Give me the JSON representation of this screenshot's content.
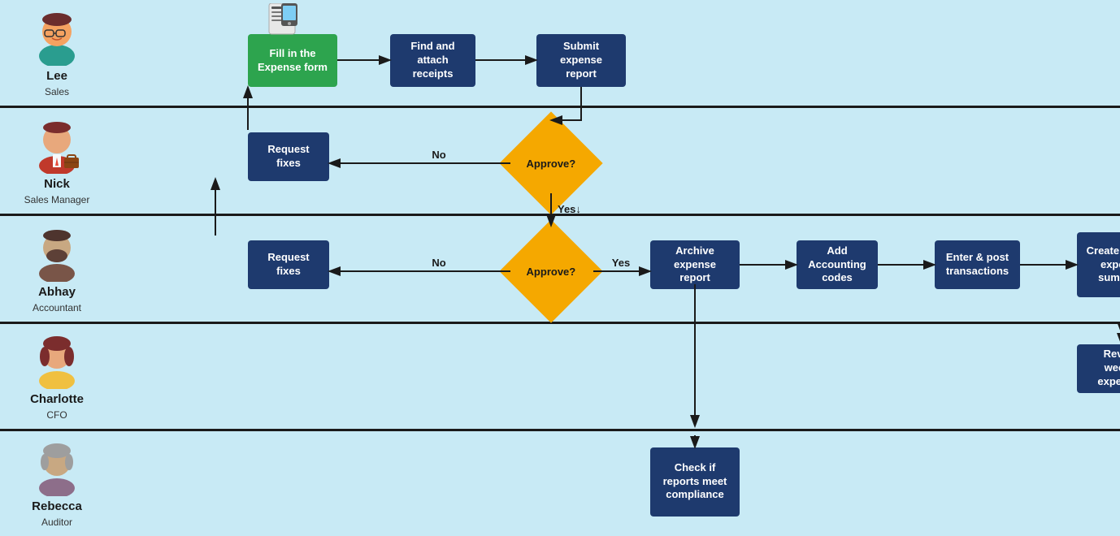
{
  "actors": {
    "lee": {
      "name": "Lee",
      "role": "Sales"
    },
    "nick": {
      "name": "Nick",
      "role": "Sales Manager"
    },
    "abhay": {
      "name": "Abhay",
      "role": "Accountant"
    },
    "charlotte": {
      "name": "Charlotte",
      "role": "CFO"
    },
    "rebecca": {
      "name": "Rebecca",
      "role": "Auditor"
    }
  },
  "boxes": {
    "fill_form": "Fill in the Expense form",
    "find_receipts": "Find and attach receipts",
    "submit_report": "Submit expense report",
    "nick_request_fixes": "Request fixes",
    "approve_nick": "Approve?",
    "abhay_request_fixes": "Request fixes",
    "approve_abhay": "Approve?",
    "archive_report": "Archive expense report",
    "add_accounting": "Add Accounting codes",
    "enter_post": "Enter & post transactions",
    "create_weekly": "Create weekly expense summary",
    "review_weekly": "Review weekly expenses",
    "check_compliance": "Check if reports meet compliance"
  },
  "labels": {
    "no": "No",
    "yes": "Yes",
    "yes_down": "Yes↓"
  },
  "colors": {
    "box_blue": "#1e3a6e",
    "box_green": "#2da44e",
    "diamond_yellow": "#f5a800",
    "bg": "#c8eaf5",
    "arrow": "#1a1a1a"
  }
}
